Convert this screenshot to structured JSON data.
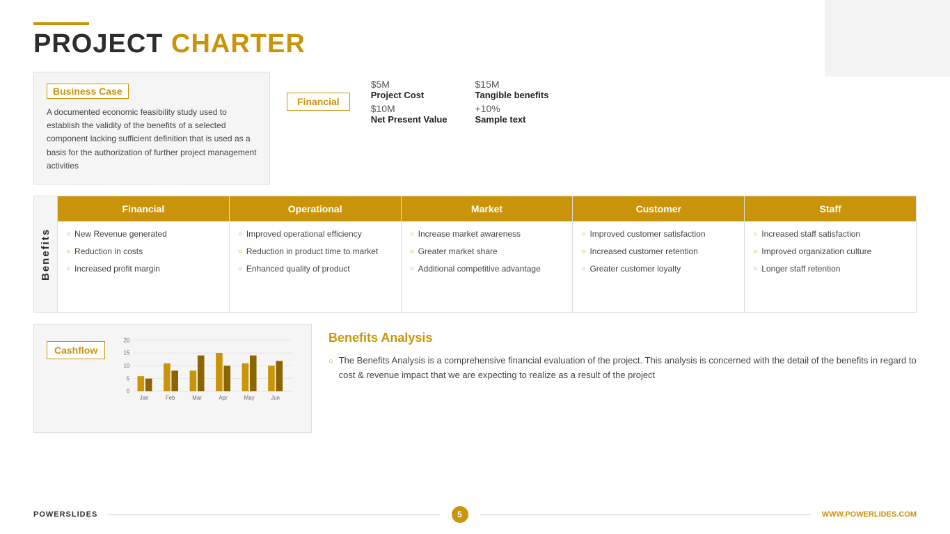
{
  "title": {
    "bar_color": "#c9940a",
    "project_text": "PROJECT",
    "charter_text": "CHARTER"
  },
  "deco_box": true,
  "business_case": {
    "label": "Business Case",
    "text": "A documented economic feasibility study used to establish the validity of the benefits of a selected component lacking sufficient definition that is used as a basis for the authorization of further project management activities"
  },
  "financial": {
    "label": "Financial",
    "items": [
      {
        "amount": "$5M",
        "label": "Project Cost"
      },
      {
        "amount": "$15M",
        "label": "Tangible benefits"
      },
      {
        "amount": "$10M",
        "label": "Net Present Value"
      },
      {
        "amount": "+10%",
        "label": "Sample text"
      }
    ]
  },
  "benefits_label": "Benefits",
  "benefits_columns": [
    {
      "header": "Financial",
      "items": [
        "New Revenue generated",
        "Reduction in costs",
        "Increased profit margin"
      ]
    },
    {
      "header": "Operational",
      "items": [
        "Improved operational efficiency",
        "Reduction in product time to market",
        "Enhanced quality of product"
      ]
    },
    {
      "header": "Market",
      "items": [
        "Increase market awareness",
        "Greater market share",
        "Additional competitive advantage"
      ]
    },
    {
      "header": "Customer",
      "items": [
        "Improved customer satisfaction",
        "Increased customer retention",
        "Greater customer loyalty"
      ]
    },
    {
      "header": "Staff",
      "items": [
        "Increased staff satisfaction",
        "Improved organization culture",
        "Longer staff retention"
      ]
    }
  ],
  "cashflow": {
    "label": "Cashflow",
    "chart": {
      "y_labels": [
        "20",
        "15",
        "10",
        "5",
        "0"
      ],
      "bars": [
        {
          "month": "Jan",
          "values": [
            6,
            5
          ]
        },
        {
          "month": "Feb",
          "values": [
            11,
            8
          ]
        },
        {
          "month": "Mar",
          "values": [
            8,
            14
          ]
        },
        {
          "month": "Apr",
          "values": [
            15,
            10
          ]
        },
        {
          "month": "May",
          "values": [
            11,
            14
          ]
        },
        {
          "month": "Jun",
          "values": [
            10,
            12
          ]
        }
      ]
    }
  },
  "benefits_analysis": {
    "title": "Benefits Analysis",
    "text": "The Benefits Analysis is a comprehensive financial evaluation of the project. This analysis is concerned with the detail of the benefits in regard to cost & revenue impact that we are expecting to realize as a result of the project"
  },
  "footer": {
    "brand": "POWERSLIDES",
    "page": "5",
    "url": "WWW.POWERLIDES.COM"
  }
}
